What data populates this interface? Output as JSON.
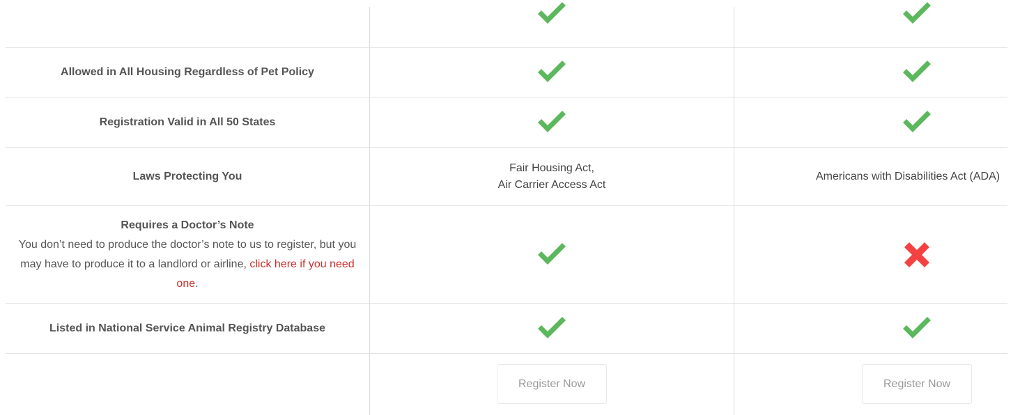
{
  "rows": {
    "top": {
      "col1": "check-icon",
      "col2": "check-icon"
    },
    "housing": {
      "label": "Allowed in All Housing Regardless of Pet Policy",
      "col1": "check-icon",
      "col2": "check-icon"
    },
    "states": {
      "label": "Registration Valid in All 50 States",
      "col1": "check-icon",
      "col2": "check-icon"
    },
    "laws": {
      "label": "Laws Protecting You",
      "col1_line1": "Fair Housing Act,",
      "col1_line2": "Air Carrier Access Act",
      "col2": "Americans with Disabilities Act (ADA)"
    },
    "doctor": {
      "title": "Requires a Doctor’s Note",
      "desc": "You don’t need to produce the doctor’s note to us to register, but you may have to produce it to a landlord or airline, ",
      "link": "click here if you need one",
      "suffix": ".",
      "col1": "check-icon",
      "col2": "cross-icon"
    },
    "registry": {
      "label": "Listed in National Service Animal Registry Database",
      "col1": "check-icon",
      "col2": "check-icon"
    },
    "actions": {
      "col1_button": "Register Now",
      "col2_button": "Register Now"
    }
  },
  "colors": {
    "check": "#5cb85c",
    "cross": "#f44242",
    "link": "#c9302c",
    "divider": "#e2e2e2"
  }
}
